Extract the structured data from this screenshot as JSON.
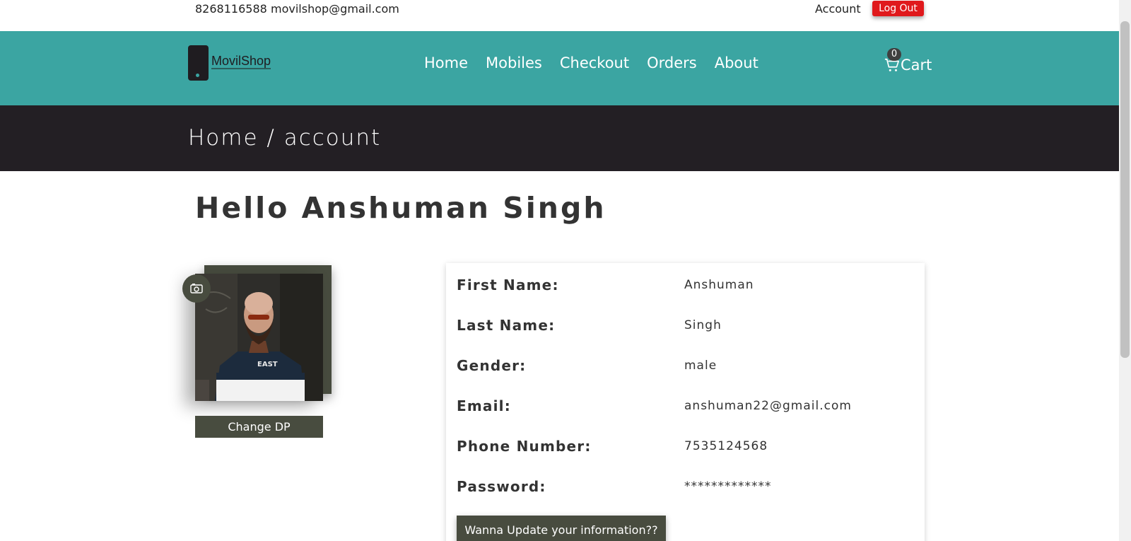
{
  "topbar": {
    "phone": "8268116588",
    "email": "movilshop@gmail.com",
    "account_label": "Account",
    "logout_label": "Log Out"
  },
  "nav": {
    "logo_text": "MovilShop",
    "links": [
      "Home",
      "Mobiles",
      "Checkout",
      "Orders",
      "About"
    ],
    "cart_count": "0",
    "cart_label": "Cart"
  },
  "breadcrumb": "Home / account",
  "greeting": "Hello Anshuman Singh",
  "profile": {
    "change_dp_label": "Change DP",
    "shirt_text": "EAST",
    "fields": [
      {
        "label": "First Name:",
        "value": "Anshuman"
      },
      {
        "label": "Last Name:",
        "value": "Singh"
      },
      {
        "label": "Gender:",
        "value": "male"
      },
      {
        "label": "Email:",
        "value": "anshuman22@gmail.com"
      },
      {
        "label": "Phone Number:",
        "value": "7535124568"
      },
      {
        "label": "Password:",
        "value": "*************"
      }
    ],
    "update_label": "Wanna Update your information??"
  },
  "colors": {
    "nav_bg": "#3ba5a2",
    "band_bg": "#231f24",
    "button_dark": "#484c3f",
    "logout_red": "#e0191c"
  }
}
